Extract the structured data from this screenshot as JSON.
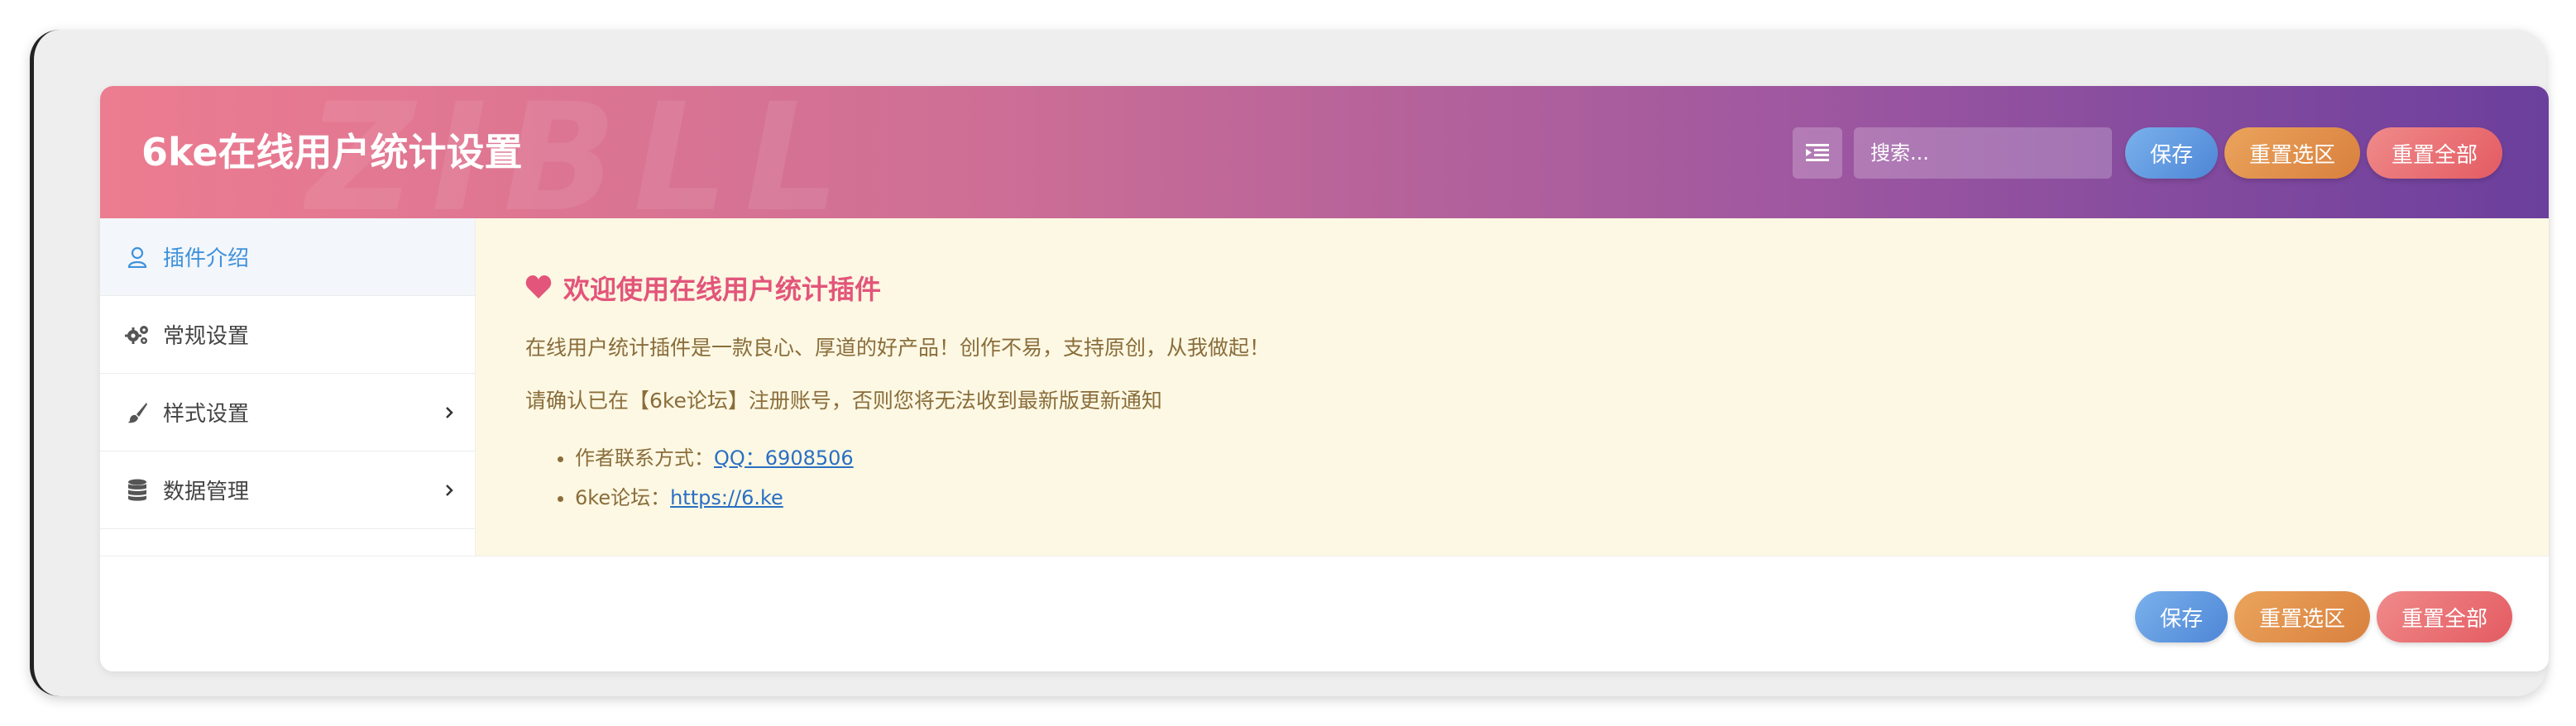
{
  "header": {
    "title": "6ke在线用户统计设置",
    "watermark": "ZIBLL",
    "search_placeholder": "搜索...",
    "expand_icon": "list-indent-icon",
    "buttons": {
      "save": "保存",
      "reset_section": "重置选区",
      "reset_all": "重置全部"
    }
  },
  "sidebar": {
    "items": [
      {
        "label": "插件介绍",
        "icon": "user-icon",
        "active": true,
        "has_children": false
      },
      {
        "label": "常规设置",
        "icon": "gears-icon",
        "active": false,
        "has_children": false
      },
      {
        "label": "样式设置",
        "icon": "paint-brush-icon",
        "active": false,
        "has_children": true
      },
      {
        "label": "数据管理",
        "icon": "database-icon",
        "active": false,
        "has_children": true
      }
    ]
  },
  "content": {
    "welcome_title": "欢迎使用在线用户统计插件",
    "para1": "在线用户统计插件是一款良心、厚道的好产品！创作不易，支持原创，从我做起！",
    "para2": "请确认已在【6ke论坛】注册账号，否则您将无法收到最新版更新通知",
    "links": [
      {
        "prefix": "作者联系方式：",
        "text": "QQ：6908506"
      },
      {
        "prefix": "6ke论坛：",
        "text": "https://6.ke"
      }
    ]
  },
  "footer": {
    "buttons": {
      "save": "保存",
      "reset_section": "重置选区",
      "reset_all": "重置全部"
    }
  },
  "colors": {
    "header_gradient_start": "#ec7c90",
    "header_gradient_end": "#6b3f9d",
    "active_nav": "#3e92dc",
    "content_bg": "#fcf8e3",
    "welcome_color": "#e3557a",
    "link_color": "#2a6fc4",
    "save_button": "#5b94dc",
    "reset_section_button": "#e08d48",
    "reset_all_button": "#e86a70"
  }
}
